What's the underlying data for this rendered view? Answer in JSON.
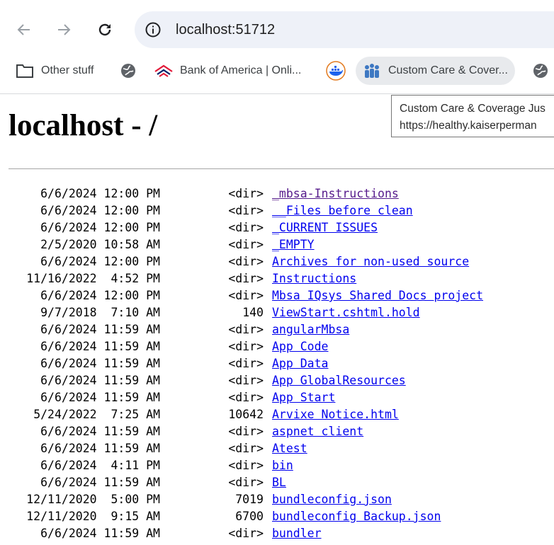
{
  "browser": {
    "url": "localhost:51712",
    "back_icon": "arrow-left-icon",
    "forward_icon": "arrow-right-icon",
    "reload_icon": "reload-icon",
    "info_icon": "info-icon"
  },
  "bookmarks": [
    {
      "label": "Other stuff",
      "icon": "folder-icon"
    },
    {
      "label": "",
      "icon": "globe-icon"
    },
    {
      "label": "Bank of America | Onli...",
      "icon": "bank-of-america-icon"
    },
    {
      "label": "",
      "icon": "docker-icon"
    },
    {
      "label": "Custom Care & Cover...",
      "icon": "people-icon"
    },
    {
      "label": "",
      "icon": "globe-icon"
    }
  ],
  "tooltip": {
    "line1": "Custom Care & Coverage Jus",
    "line2": "https://healthy.kaiserperman"
  },
  "page": {
    "title": "localhost - /"
  },
  "listing": [
    {
      "date": "6/6/2024 12:00 PM",
      "size": "<dir>",
      "name": "_mbsa-Instructions",
      "visited": true
    },
    {
      "date": "6/6/2024 12:00 PM",
      "size": "<dir>",
      "name": "__Files before clean",
      "visited": false
    },
    {
      "date": "6/6/2024 12:00 PM",
      "size": "<dir>",
      "name": "_CURRENT ISSUES",
      "visited": false
    },
    {
      "date": "2/5/2020 10:58 AM",
      "size": "<dir>",
      "name": "_EMPTY",
      "visited": false
    },
    {
      "date": "6/6/2024 12:00 PM",
      "size": "<dir>",
      "name": "Archives for non-used source",
      "visited": false
    },
    {
      "date": "11/16/2022  4:52 PM",
      "size": "<dir>",
      "name": "Instructions",
      "visited": false
    },
    {
      "date": "6/6/2024 12:00 PM",
      "size": "<dir>",
      "name": "Mbsa IQsys Shared Docs project",
      "visited": false
    },
    {
      "date": "9/7/2018  7:10 AM",
      "size": "140",
      "name": "ViewStart.cshtml.hold",
      "visited": false
    },
    {
      "date": "6/6/2024 11:59 AM",
      "size": "<dir>",
      "name": "angularMbsa",
      "visited": false
    },
    {
      "date": "6/6/2024 11:59 AM",
      "size": "<dir>",
      "name": "App Code",
      "visited": false
    },
    {
      "date": "6/6/2024 11:59 AM",
      "size": "<dir>",
      "name": "App Data",
      "visited": false
    },
    {
      "date": "6/6/2024 11:59 AM",
      "size": "<dir>",
      "name": "App GlobalResources",
      "visited": false
    },
    {
      "date": "6/6/2024 11:59 AM",
      "size": "<dir>",
      "name": "App Start",
      "visited": false
    },
    {
      "date": "5/24/2022  7:25 AM",
      "size": "10642",
      "name": "Arvixe Notice.html",
      "visited": false
    },
    {
      "date": "6/6/2024 11:59 AM",
      "size": "<dir>",
      "name": "aspnet client",
      "visited": false
    },
    {
      "date": "6/6/2024 11:59 AM",
      "size": "<dir>",
      "name": "Atest",
      "visited": false
    },
    {
      "date": "6/6/2024  4:11 PM",
      "size": "<dir>",
      "name": "bin",
      "visited": false
    },
    {
      "date": "6/6/2024 11:59 AM",
      "size": "<dir>",
      "name": "BL",
      "visited": false
    },
    {
      "date": "12/11/2020  5:00 PM",
      "size": "7019",
      "name": "bundleconfig.json",
      "visited": false
    },
    {
      "date": "12/11/2020  9:15 AM",
      "size": "6700",
      "name": "bundleconfig Backup.json",
      "visited": false
    },
    {
      "date": "6/6/2024 11:59 AM",
      "size": "<dir>",
      "name": "bundler",
      "visited": false
    }
  ]
}
